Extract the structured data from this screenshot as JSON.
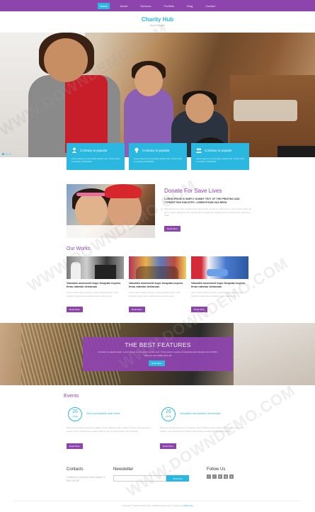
{
  "nav": {
    "items": [
      {
        "label": "Home",
        "active": true
      },
      {
        "label": "About",
        "active": false
      },
      {
        "label": "Services",
        "active": false
      },
      {
        "label": "Portfolio",
        "active": false
      },
      {
        "label": "Blog",
        "active": false
      },
      {
        "label": "Contact",
        "active": false
      }
    ]
  },
  "brand": {
    "name": "Charity Hub",
    "tagline": "Slow Website"
  },
  "features": [
    {
      "icon": "user-icon",
      "title": "Contrary to popular",
      "text": "Lorem ipsum is not simply random text. It has roots in a piece of classical"
    },
    {
      "icon": "lightbulb-icon",
      "title": "Contrary to popular",
      "text": "Lorem ipsum is not simply random text. It has roots in a piece of classical"
    },
    {
      "icon": "group-icon",
      "title": "Contrary to popular",
      "text": "Lorem ipsum is not simply random text. It has roots in a piece of classical"
    }
  ],
  "donate": {
    "title": "Donate For Save Lives",
    "subtitle": "LOREM IPSUM IS SIMPLY DUMMY TEXT OF THE PRINTING AND TYPESETTING INDUSTRY. LOREM IPSUM HAS BEEN",
    "text": "Molestie lorem ornare consectetuer amet lorem nonummy vitae lorem. Lorem ipsum dolor sit amet, conse adipiscing elit. Cras tincidunt maecenas molestie lorem ornare amet nonummy vitae.",
    "button": "Read More"
  },
  "works": {
    "title": "Our Works",
    "items": [
      {
        "title": "Vassales assessent kuyo fecuptas nuyess feras ratentar dertaesas",
        "text": "Lorem ipsum dolor sit amet, conse adipiscing elit. Cras tincidunt maecenas molestie lorem ornare amet.",
        "button": "Read More"
      },
      {
        "title": "Vassales assessent kuyo fecuptas nuyess feras ratentar dertaesas",
        "text": "Lorem ipsum dolor sit amet, conse adipiscing elit. Cras tincidunt maecenas molestie lorem ornare amet.",
        "button": "Read More"
      },
      {
        "title": "Vassales assessent kuyo fecuptas nuyess feras ratentar dertaesas",
        "text": "Lorem ipsum dolor sit amet, conse adipiscing elit. Cras tincidunt maecenas molestie lorem ornare amet.",
        "button": "Read More"
      }
    ]
  },
  "banner": {
    "title": "THE BEST FEATURES",
    "text": "Contrary to popular belief, Lorem Ipsum is not simply random text. It has roots in a piece of classical Latin literature from 45 BC, making it over 2000 years old.",
    "button": "Read More"
  },
  "events": {
    "title": "Events",
    "items": [
      {
        "day": "26",
        "month": "JUNE",
        "title": "Sed ut perspiciatis unde omnis",
        "text": "Nostrud, Accusam Nonummy, Magna, Amet. Aliquam erat volutpat. Ut wisi enim ad minim veniam, quis nostrud exerci tation ullamcorper suscipit lobortis nisl ut aliquip.",
        "button": "Read More"
      },
      {
        "day": "26",
        "month": "APRIL",
        "title": "Voluptatem accusantium doloremque",
        "text": "Nostrud, Accusam Nonummy, Magna, Amet. Aliquam erat volutpat. Ut wisi enim ad minim veniam, quis nostrud exerci tation ullamcorper suscipit lobortis nisl ut aliquip.",
        "button": "Read More"
      }
    ]
  },
  "footer": {
    "contacts_title": "Contacts",
    "contacts_text": "Contrary to popular Lorem ipsum 1-800-234-56",
    "newsletter_title": "Newsletter",
    "newsletter_placeholder": "",
    "subscribe_button": "Subscribe",
    "follow_title": "Follow Us",
    "social": [
      "f",
      "t",
      "in",
      "g",
      "p"
    ],
    "copyright_text": "Copyright © 2015 Charity Hub. All Rights Reserved. Template by",
    "copyright_link": "W3layouts"
  },
  "watermark": "WWW.DOWNDEMO.COM",
  "colors": {
    "accent": "#8e44ad",
    "secondary": "#2ab7e0"
  }
}
